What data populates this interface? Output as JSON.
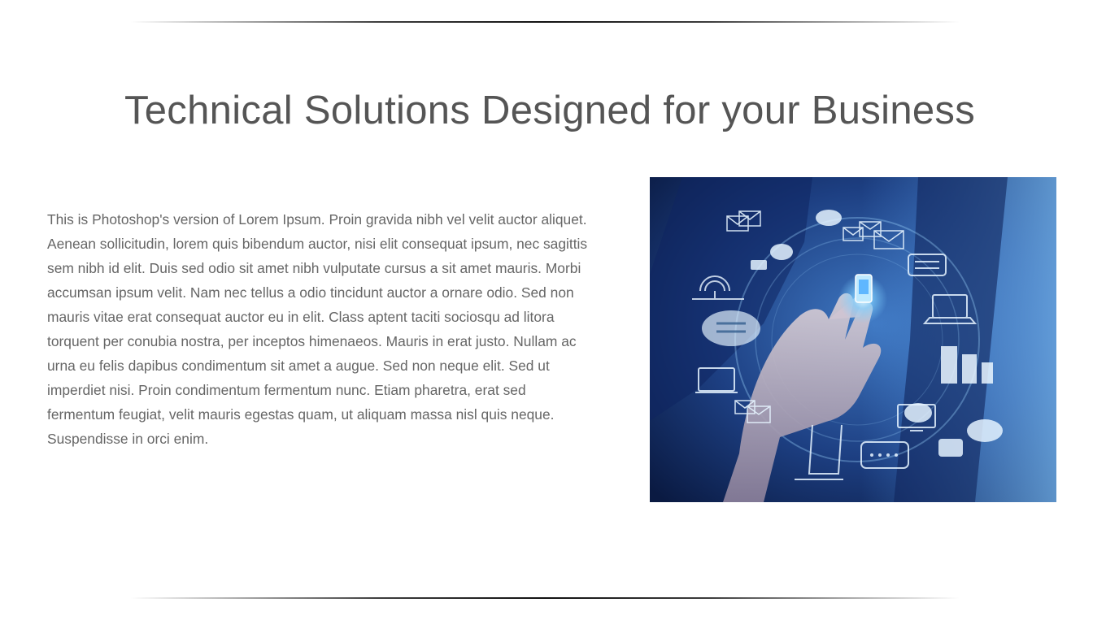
{
  "slide": {
    "title": "Technical Solutions Designed for your Business",
    "body": "This is Photoshop's version  of Lorem Ipsum. Proin gravida nibh vel velit auctor aliquet. Aenean sollicitudin, lorem quis bibendum auctor, nisi elit consequat ipsum, nec sagittis sem nibh id elit. Duis sed odio sit amet nibh vulputate cursus a sit amet mauris. Morbi accumsan ipsum velit. Nam nec tellus a odio tincidunt auctor a ornare odio. Sed non  mauris vitae erat consequat auctor eu in elit. Class aptent taciti sociosqu ad litora torquent per conubia nostra, per inceptos himenaeos. Mauris in erat justo. Nullam ac urna eu felis dapibus condimentum sit amet a augue. Sed non neque elit. Sed ut imperdiet nisi. Proin condimentum fermentum nunc. Etiam pharetra, erat sed fermentum feugiat, velit mauris egestas quam, ut aliquam massa nisl quis neque. Suspendisse in orci enim."
  },
  "image": {
    "icons": [
      "mail-icon",
      "chat-icon",
      "signal-tower-icon",
      "phone-icon",
      "laptop-icon",
      "server-icon",
      "monitor-icon",
      "tablet-icon"
    ],
    "colors": {
      "accent": "#7fd0ff",
      "background_dark": "#0c1f4a",
      "background_light": "#4a8fd8"
    }
  }
}
